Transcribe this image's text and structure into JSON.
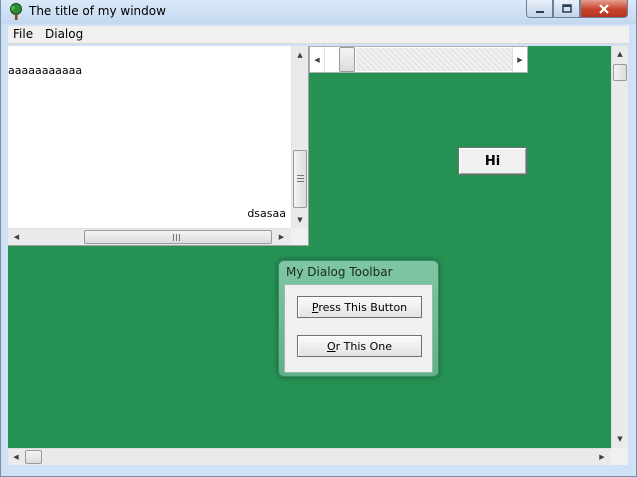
{
  "window": {
    "title": "The title of my window",
    "icon": "tree-icon",
    "controls": {
      "minimize": "minimize-icon",
      "maximize": "maximize-icon",
      "close": "close-icon"
    }
  },
  "menu": {
    "items": [
      "File",
      "Dialog"
    ]
  },
  "colors": {
    "client_background": "#259153",
    "dialog_background": "#6fbd96"
  },
  "text_window": {
    "line1": "aaaaaaaaaaa",
    "line2": "dsasaa"
  },
  "hi_button": {
    "label": "Hi"
  },
  "dialog": {
    "title": "My Dialog Toolbar",
    "buttons": [
      {
        "mnemonic": "P",
        "rest": "ress This Button"
      },
      {
        "mnemonic": "O",
        "rest": "r This One"
      }
    ]
  }
}
